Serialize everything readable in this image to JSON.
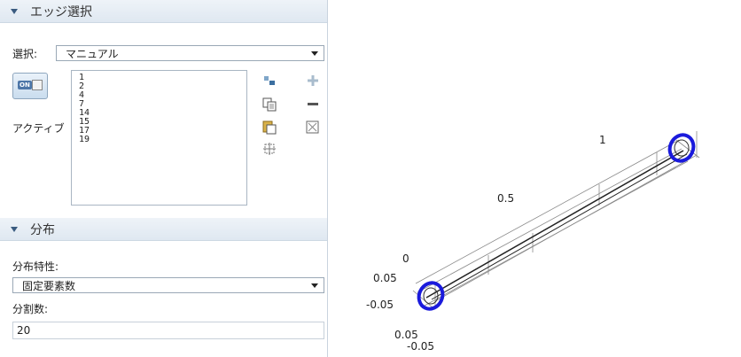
{
  "edge_section": {
    "title": "エッジ選択"
  },
  "selection": {
    "label": "選択:",
    "value": "マニュアル"
  },
  "active_toggle": {
    "on_text": "ON",
    "label": "アクティブ"
  },
  "edge_list": [
    "1",
    "2",
    "4",
    "7",
    "14",
    "15",
    "17",
    "19"
  ],
  "distribution_section": {
    "title": "分布"
  },
  "distribution_property": {
    "label": "分布特性:",
    "value": "固定要素数"
  },
  "num_elements": {
    "label": "分割数:",
    "value": "20"
  },
  "plot": {
    "labels": {
      "tick_1": "1",
      "tick_0_5": "0.5",
      "tick_0": "0",
      "y_pos": "0.05",
      "y_neg": "-0.05",
      "x_pos": "0.05",
      "x_neg": "-0.05"
    },
    "ring_color": "#1a1adc"
  }
}
